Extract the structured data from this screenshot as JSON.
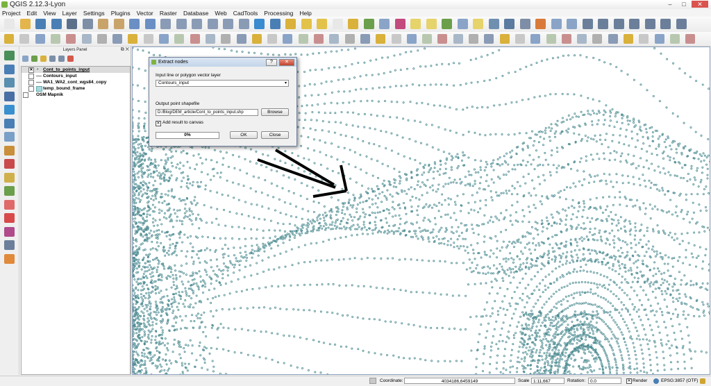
{
  "window": {
    "title": "QGIS 2.12.3-Lyon",
    "minimize": "–",
    "maximize": "□",
    "close": "✕"
  },
  "menu": [
    "Project",
    "Edit",
    "View",
    "Layer",
    "Settings",
    "Plugins",
    "Vector",
    "Raster",
    "Database",
    "Web",
    "CadTools",
    "Processing",
    "Help"
  ],
  "layers_panel": {
    "title": "Layers Panel",
    "float_button": "⧉",
    "close_button": "✕",
    "layers": [
      {
        "name": "Cont_to_points_input",
        "checked": true,
        "selected": true,
        "type": "point"
      },
      {
        "name": "Contours_input",
        "checked": false,
        "selected": false,
        "type": "line"
      },
      {
        "name": "WA1_WA2_cont_wgs84_copy",
        "checked": false,
        "selected": false,
        "type": "line"
      },
      {
        "name": "temp_bound_frame",
        "checked": false,
        "selected": false,
        "type": "polygon"
      },
      {
        "name": "OSM Mapnik",
        "checked": false,
        "selected": false,
        "type": "raster"
      }
    ]
  },
  "dialog": {
    "title": "Extract nodes",
    "help_button": "?",
    "close_button": "✕",
    "input_label": "Input line or polygon vector layer",
    "input_value": "Contours_input",
    "output_label": "Output point shapefile",
    "output_value": "D:/Blog/DEM_article/Cont_to_points_input.shp",
    "browse_label": "Browse",
    "add_result_label": "Add result to canvas",
    "add_result_checked": true,
    "progress_text": "0%",
    "progress_value": 0,
    "ok_label": "OK",
    "close_label": "Close"
  },
  "status": {
    "coordinate_label": "Coordinate:",
    "coordinate_value": "4034186,6459149",
    "scale_label": "Scale",
    "scale_value": "1:11,667",
    "rotation_label": "Rotation:",
    "rotation_value": "0.0",
    "render_label": "Render",
    "render_checked": true,
    "crs_label": "EPSG:3857 (OTF)"
  },
  "colors": {
    "point": "#4a8a90",
    "accent": "#7fb341"
  }
}
